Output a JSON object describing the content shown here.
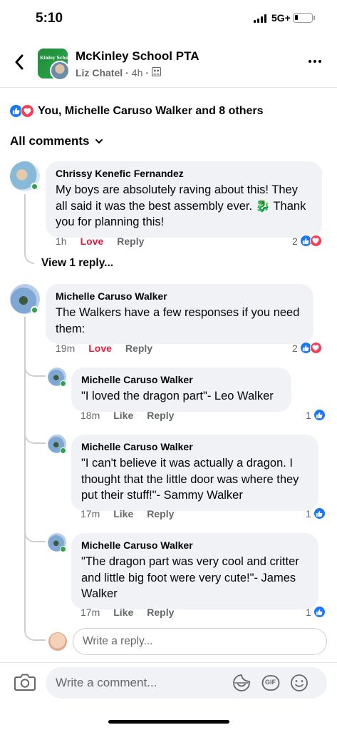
{
  "status": {
    "time": "5:10",
    "network": "5G+",
    "battery_level": 0.2
  },
  "header": {
    "group_name": "McKinley School PTA",
    "group_avatar_text": "Kinley School P",
    "poster": "Liz Chatel",
    "age": "4h",
    "separator": "·"
  },
  "reactions": {
    "summary": "You, Michelle Caruso Walker and 8 others"
  },
  "comments_header": {
    "label": "All comments"
  },
  "comments": [
    {
      "author": "Chrissy Kenefic Fernandez",
      "text_before": "My boys are absolutely raving about this! They all said it was the best assembly ever. ",
      "emoji": "🐉",
      "text_after": " Thank you for planning this!",
      "time": "1h",
      "action1": "Love",
      "reply_label": "Reply",
      "reaction_count": "2"
    },
    {
      "author": "Michelle Caruso Walker",
      "text": "The Walkers have a few responses if you need them:",
      "time": "19m",
      "action1": "Love",
      "reply_label": "Reply",
      "reaction_count": "2"
    }
  ],
  "view_replies": "View 1 reply...",
  "replies": [
    {
      "author": "Michelle Caruso Walker",
      "text": "\"I loved the dragon part\"- Leo Walker",
      "time": "18m",
      "like_label": "Like",
      "reply_label": "Reply",
      "reaction_count": "1"
    },
    {
      "author": "Michelle Caruso Walker",
      "text": "\"I can't believe it was actually a dragon. I thought that the little door was where they put their stuff!\"- Sammy Walker",
      "time": "17m",
      "like_label": "Like",
      "reply_label": "Reply",
      "reaction_count": "1"
    },
    {
      "author": "Michelle Caruso Walker",
      "text": "\"The dragon part was very cool and critter and little big foot were very cute!\"- James Walker",
      "time": "17m",
      "like_label": "Like",
      "reply_label": "Reply",
      "reaction_count": "1"
    }
  ],
  "reply_input": {
    "placeholder": "Write a reply..."
  },
  "composer": {
    "placeholder": "Write a comment...",
    "gif_label": "GIF"
  },
  "colors": {
    "like_blue": "#1877f2",
    "love_red": "#f33e58",
    "love_text": "#e41e3f",
    "bubble": "#f0f2f5",
    "secondary_text": "#65676b",
    "online_green": "#31a24c"
  },
  "icons": [
    "back-chevron-icon",
    "more-icon",
    "audience-icon",
    "like-reaction-icon",
    "love-reaction-icon",
    "chevron-down-icon",
    "camera-icon",
    "sticker-icon",
    "gif-icon",
    "emoji-icon"
  ]
}
